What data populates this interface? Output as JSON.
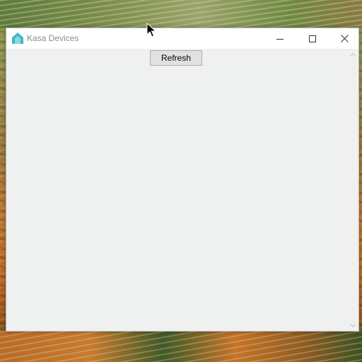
{
  "window": {
    "title": "Kasa Devices",
    "icon": "kasa-house-icon",
    "accent_color": "#3fb8c8",
    "controls": {
      "minimize": "minimize-icon",
      "maximize": "maximize-icon",
      "close": "close-icon"
    }
  },
  "toolbar": {
    "refresh_label": "Refresh"
  },
  "scrollbar": {
    "up_icon": "chevron-up-icon",
    "down_icon": "chevron-down-icon"
  }
}
